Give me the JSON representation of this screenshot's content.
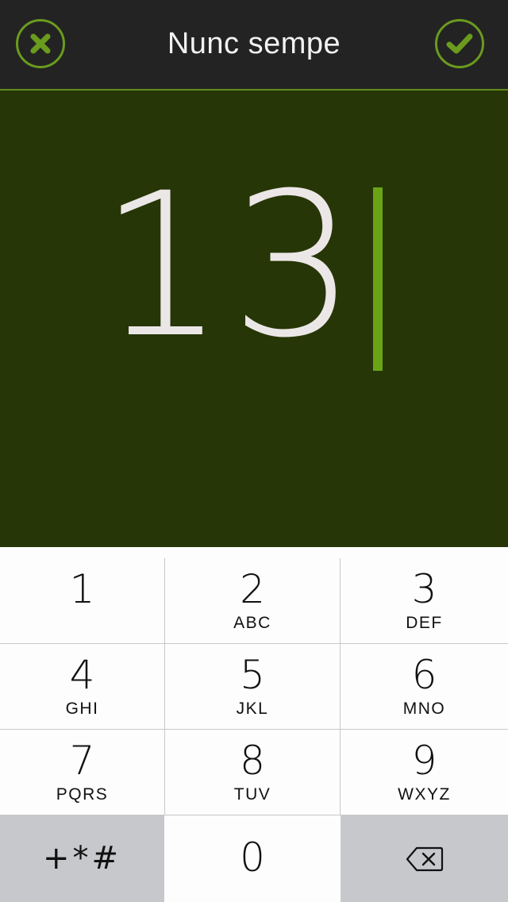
{
  "header": {
    "title": "Nunc sempe",
    "cancel_icon": "close-icon",
    "confirm_icon": "check-icon"
  },
  "entry": {
    "value": "13"
  },
  "keypad": {
    "keys": [
      {
        "digit": "1",
        "letters": ""
      },
      {
        "digit": "2",
        "letters": "ABC"
      },
      {
        "digit": "3",
        "letters": "DEF"
      },
      {
        "digit": "4",
        "letters": "GHI"
      },
      {
        "digit": "5",
        "letters": "JKL"
      },
      {
        "digit": "6",
        "letters": "MNO"
      },
      {
        "digit": "7",
        "letters": "PQRS"
      },
      {
        "digit": "8",
        "letters": "TUV"
      },
      {
        "digit": "9",
        "letters": "WXYZ"
      }
    ],
    "symbols_label": "+*#",
    "zero": "0",
    "backspace_icon": "backspace-icon"
  },
  "colors": {
    "header_bg": "#232323",
    "accent": "#6a9b1e",
    "entry_bg": "#263606",
    "caret": "#6aa416",
    "gray_key": "#c6c8cb"
  }
}
